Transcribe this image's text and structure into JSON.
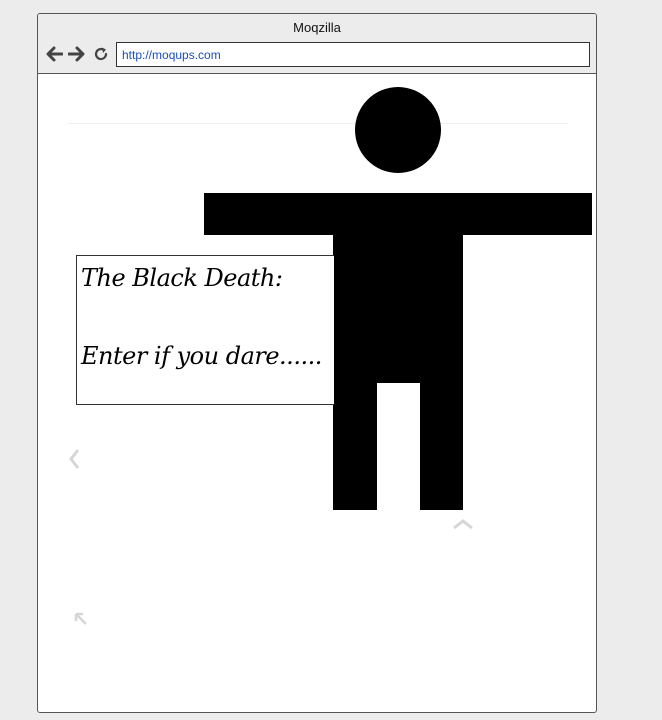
{
  "window": {
    "title": "Moqzilla"
  },
  "nav": {
    "back_icon": "arrow-left-icon",
    "forward_icon": "arrow-right-icon",
    "reload_icon": "reload-icon"
  },
  "address_bar": {
    "url": "http://moqups.com"
  },
  "textbox": {
    "line1": "The Black Death:",
    "line2": "Enter if you dare......"
  },
  "figure": {
    "color": "#000000"
  },
  "ghost_icons": {
    "left": "chevron-left-icon",
    "up": "chevron-up-icon",
    "corner": "arrow-up-left-icon"
  }
}
